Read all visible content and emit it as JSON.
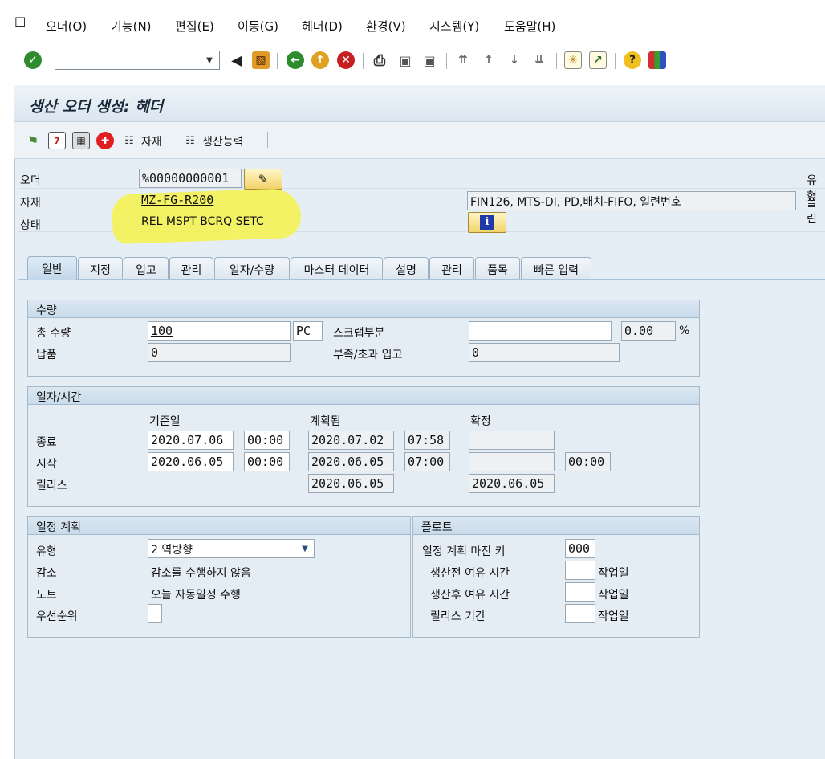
{
  "menu": {
    "items": [
      {
        "label": "오더(O)"
      },
      {
        "label": "기능(N)"
      },
      {
        "label": "편집(E)"
      },
      {
        "label": "이동(G)"
      },
      {
        "label": "헤더(D)"
      },
      {
        "label": "환경(V)"
      },
      {
        "label": "시스템(Y)"
      },
      {
        "label": "도움말(H)"
      }
    ]
  },
  "toolbar": {
    "command_value": ""
  },
  "screen": {
    "title": "생산 오더 생성: 헤더"
  },
  "app_toolbar": {
    "material_label": "자재",
    "capacity_label": "생산능력"
  },
  "header": {
    "order_label": "오더",
    "order_value": "%00000000001",
    "material_label": "자재",
    "material_value": "MZ-FG-R200",
    "material_desc": "FIN126, MTS-DI, PD,배치-FIFO, 일련번호",
    "status_label": "상태",
    "status_value": "REL  MSPT BCRQ SETC",
    "type_label_cut": "유형",
    "plant_label_cut": "플린"
  },
  "tabs": [
    {
      "label": "일반"
    },
    {
      "label": "지정"
    },
    {
      "label": "입고"
    },
    {
      "label": "관리"
    },
    {
      "label": "일자/수량"
    },
    {
      "label": "마스터 데이터"
    },
    {
      "label": "설명"
    },
    {
      "label": "관리"
    },
    {
      "label": "품목"
    },
    {
      "label": "빠른 입력"
    }
  ],
  "quantity": {
    "title": "수량",
    "total_label": "총 수량",
    "total_value": "100",
    "unit": "PC",
    "scrap_label": "스크랩부분",
    "scrap_value": "",
    "scrap_pct": "0.00",
    "pct_sign": "%",
    "delivered_label": "납품",
    "delivered_value": "0",
    "short_over_label": "부족/초과 입고",
    "short_over_value": "0"
  },
  "dates": {
    "title": "일자/시간",
    "col_basic": "기준일",
    "col_scheduled": "계획됨",
    "col_confirmed": "확정",
    "end_label": "종료",
    "start_label": "시작",
    "release_label": "릴리스",
    "end_basic_date": "2020.07.06",
    "end_basic_time": "00:00",
    "end_sched_date": "2020.07.02",
    "end_sched_time": "07:58",
    "end_conf_date": "",
    "start_basic_date": "2020.06.05",
    "start_basic_time": "00:00",
    "start_sched_date": "2020.06.05",
    "start_sched_time": "07:00",
    "start_conf_date": "",
    "start_conf_time": "00:00",
    "release_sched": "2020.06.05",
    "release_conf": "2020.06.05"
  },
  "scheduling": {
    "title": "일정 계획",
    "type_label": "유형",
    "type_value": "2 역방향",
    "reduction_label": "감소",
    "reduction_value": "감소를 수행하지 않음",
    "note_label": "노트",
    "note_value": "오늘 자동일정 수행",
    "priority_label": "우선순위",
    "priority_value": ""
  },
  "float": {
    "title": "플로트",
    "margin_key_label": "일정 계획 마진 키",
    "margin_key_value": "000",
    "pre_label": "생산전 여유 시간",
    "pre_value": "",
    "post_label": "생산후 여유 시간",
    "post_value": "",
    "release_label": "릴리스 기간",
    "release_value": "",
    "unit": "작업일"
  },
  "colors": {
    "highlight": "#f4f24a",
    "panel": "#e4ecf4",
    "tab_active": "#c3d7ea"
  }
}
